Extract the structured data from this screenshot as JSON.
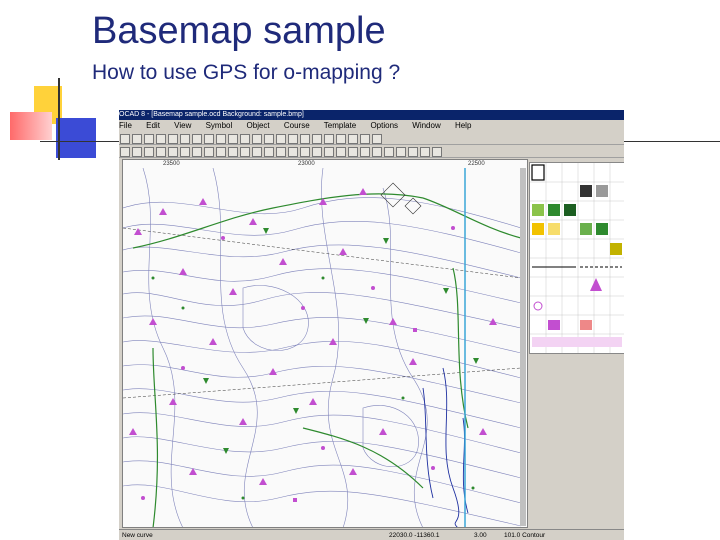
{
  "slide": {
    "title": "Basemap sample",
    "subtitle": "How to use GPS for o-mapping ?"
  },
  "app": {
    "titlebar": "OCAD 8 - [Basemap sample.ocd  Background: sample.bmp]",
    "menu": [
      "File",
      "Edit",
      "View",
      "Symbol",
      "Object",
      "Course",
      "Template",
      "Options",
      "Window",
      "Help"
    ],
    "map_coords": [
      "23500",
      "23000",
      "22500"
    ],
    "status": {
      "left": "New curve",
      "coord": "22030.0   -11360.1",
      "zoom": "3.00",
      "symbol": "101.0 Contour"
    }
  },
  "colors": {
    "contour": "#6a6fb0",
    "vegetation": "#2e8a2e",
    "controls": "#c24ed0",
    "gps_track": "#3aa6d8",
    "water": "#1d2fa0"
  }
}
